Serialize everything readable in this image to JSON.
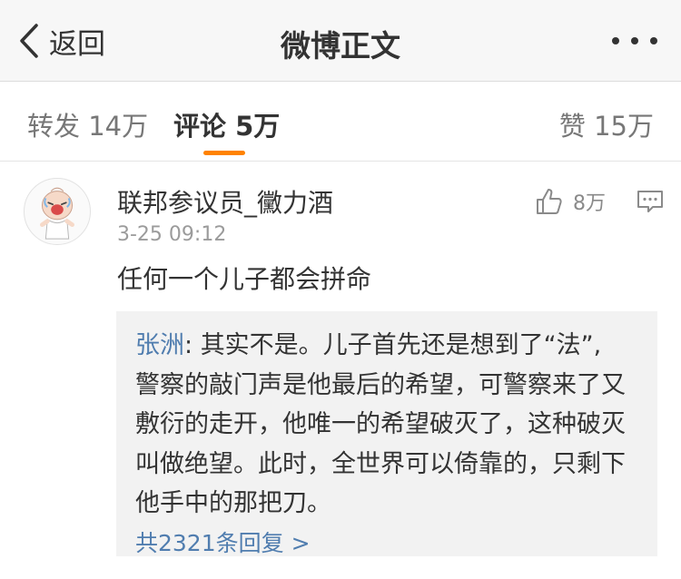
{
  "nav": {
    "back_label": "返回",
    "title": "微博正文"
  },
  "tabs": {
    "repost": "转发 14万",
    "comment": "评论 5万",
    "like": "赞 15万",
    "accent_color": "#ff8200"
  },
  "comment": {
    "username": "联邦参议员_黴力酒",
    "timestamp": "3-25 09:12",
    "like_count": "8万",
    "text": "任何一个儿子都会拼命",
    "icons": {
      "avatar": "crying-baby-avatar",
      "like": "thumbs-up-icon",
      "reply": "comment-icon"
    }
  },
  "reply": {
    "author": "张洲",
    "separator": ": ",
    "first_line": "其实不是。儿子首先还是想到了“法”,",
    "lines": [
      "警察的敲门声是他最后的希望，可警察来了又",
      "敷衍的走开，他唯一的希望破灭了，这种破灭",
      "叫做绝望。此时，全世界可以倚靠的，只剩下",
      "他手中的那把刀。"
    ],
    "more_label": "共2321条回复 >",
    "link_color": "#507daf"
  }
}
